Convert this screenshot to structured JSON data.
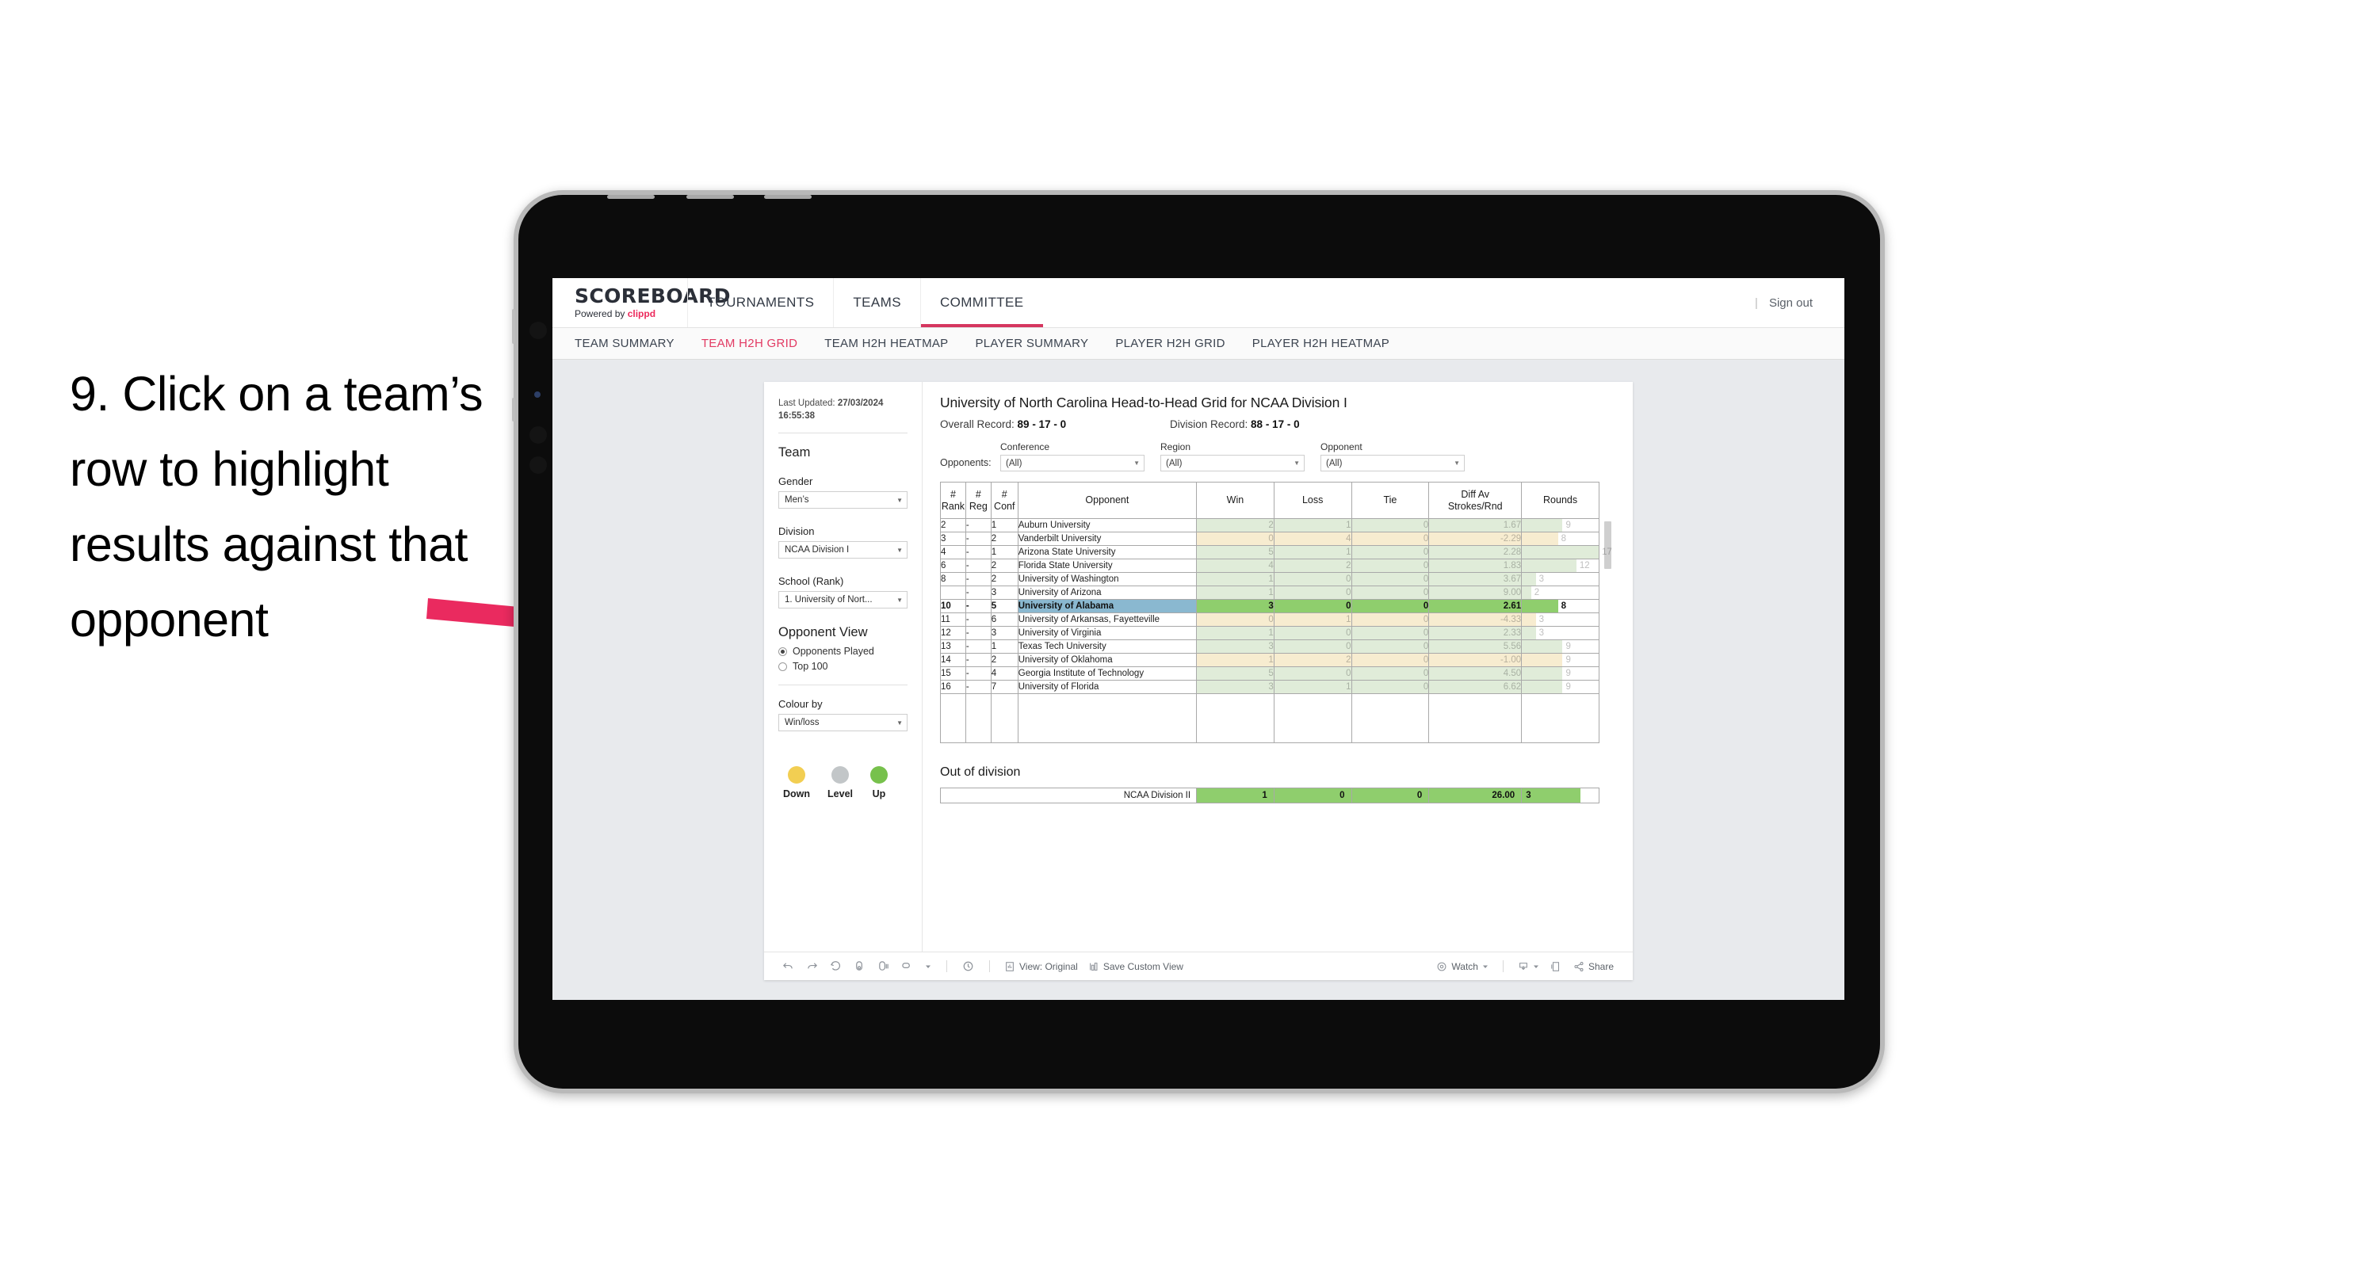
{
  "annotation": {
    "text": "9. Click on a team’s row to highlight results against that opponent",
    "arrow_color": "#ea2a5f"
  },
  "topnav": {
    "logo": "SCOREBOARD",
    "powered_prefix": "Powered by ",
    "powered_brand": "clippd",
    "items": [
      {
        "label": "TOURNAMENTS",
        "active": false
      },
      {
        "label": "TEAMS",
        "active": false
      },
      {
        "label": "COMMITTEE",
        "active": true
      }
    ],
    "separator": "|",
    "sign_out": "Sign out",
    "accent": "#d5365f"
  },
  "subnav": {
    "items": [
      {
        "label": "TEAM SUMMARY",
        "active": false
      },
      {
        "label": "TEAM H2H GRID",
        "active": true
      },
      {
        "label": "TEAM H2H HEATMAP",
        "active": false
      },
      {
        "label": "PLAYER SUMMARY",
        "active": false
      },
      {
        "label": "PLAYER H2H GRID",
        "active": false
      },
      {
        "label": "PLAYER H2H HEATMAP",
        "active": false
      }
    ]
  },
  "sidebar": {
    "last_updated_label": "Last Updated: ",
    "last_updated_value": "27/03/2024 16:55:38",
    "team_heading": "Team",
    "gender_label": "Gender",
    "gender_value": "Men’s",
    "division_label": "Division",
    "division_value": "NCAA Division I",
    "school_label": "School (Rank)",
    "school_value": "1. University of Nort...",
    "opponent_view_heading": "Opponent View",
    "opponent_view_options": [
      {
        "label": "Opponents Played",
        "selected": true
      },
      {
        "label": "Top 100",
        "selected": false
      }
    ],
    "colour_by_label": "Colour by",
    "colour_by_value": "Win/loss",
    "legend": [
      {
        "label": "Down",
        "color": "#f2ce52"
      },
      {
        "label": "Level",
        "color": "#c2c6c8"
      },
      {
        "label": "Up",
        "color": "#77c14c"
      }
    ]
  },
  "viz": {
    "title": "University of North Carolina Head-to-Head Grid for NCAA Division I",
    "overall_record_label": "Overall Record: ",
    "overall_record_value": "89 - 17 - 0",
    "division_record_label": "Division Record: ",
    "division_record_value": "88 - 17 - 0",
    "opponents_label": "Opponents:",
    "filters": [
      {
        "label": "Conference",
        "value": "(All)"
      },
      {
        "label": "Region",
        "value": "(All)"
      },
      {
        "label": "Opponent",
        "value": "(All)"
      }
    ],
    "out_of_division_title": "Out of division"
  },
  "chart_data": {
    "type": "table",
    "title": "University of North Carolina Head-to-Head Grid for NCAA Division I",
    "columns": [
      "# Rank",
      "# Reg",
      "# Conf",
      "Opponent",
      "Win",
      "Loss",
      "Tie",
      "Diff Av Strokes/Rnd",
      "Rounds"
    ],
    "column_header_lines": [
      [
        "#",
        "Rank"
      ],
      [
        "#",
        "Reg"
      ],
      [
        "#",
        "Conf"
      ],
      [
        "Opponent"
      ],
      [
        "Win"
      ],
      [
        "Loss"
      ],
      [
        "Tie"
      ],
      [
        "Diff Av",
        "Strokes/Rnd"
      ],
      [
        "Rounds"
      ]
    ],
    "rounds_max": 17,
    "rows": [
      {
        "rank": "2",
        "reg": "-",
        "conf": "1",
        "opponent": "Auburn University",
        "win": "2",
        "loss": "1",
        "tie": "0",
        "diff": "1.67",
        "rounds": "9",
        "color": "#e0ecd9",
        "highlight": false
      },
      {
        "rank": "3",
        "reg": "-",
        "conf": "2",
        "opponent": "Vanderbilt University",
        "win": "0",
        "loss": "4",
        "tie": "0",
        "diff": "-2.29",
        "rounds": "8",
        "color": "#f7ecd0",
        "highlight": false
      },
      {
        "rank": "4",
        "reg": "-",
        "conf": "1",
        "opponent": "Arizona State University",
        "win": "5",
        "loss": "1",
        "tie": "0",
        "diff": "2.28",
        "rounds": "17",
        "color": "#e0ecd9",
        "highlight": false
      },
      {
        "rank": "6",
        "reg": "-",
        "conf": "2",
        "opponent": "Florida State University",
        "win": "4",
        "loss": "2",
        "tie": "0",
        "diff": "1.83",
        "rounds": "12",
        "color": "#e0ecd9",
        "highlight": false
      },
      {
        "rank": "8",
        "reg": "-",
        "conf": "2",
        "opponent": "University of Washington",
        "win": "1",
        "loss": "0",
        "tie": "0",
        "diff": "3.67",
        "rounds": "3",
        "color": "#e0ecd9",
        "highlight": false
      },
      {
        "rank": "",
        "reg": "-",
        "conf": "3",
        "opponent": "University of Arizona",
        "win": "1",
        "loss": "0",
        "tie": "0",
        "diff": "9.00",
        "rounds": "2",
        "color": "#e0ecd9",
        "highlight": false
      },
      {
        "rank": "10",
        "reg": "-",
        "conf": "5",
        "opponent": "University of Alabama",
        "win": "3",
        "loss": "0",
        "tie": "0",
        "diff": "2.61",
        "rounds": "8",
        "color": "#8fce6d",
        "highlight": true
      },
      {
        "rank": "11",
        "reg": "-",
        "conf": "6",
        "opponent": "University of Arkansas, Fayetteville",
        "win": "0",
        "loss": "1",
        "tie": "0",
        "diff": "-4.33",
        "rounds": "3",
        "color": "#f7ecd0",
        "highlight": false
      },
      {
        "rank": "12",
        "reg": "-",
        "conf": "3",
        "opponent": "University of Virginia",
        "win": "1",
        "loss": "0",
        "tie": "0",
        "diff": "2.33",
        "rounds": "3",
        "color": "#e0ecd9",
        "highlight": false
      },
      {
        "rank": "13",
        "reg": "-",
        "conf": "1",
        "opponent": "Texas Tech University",
        "win": "3",
        "loss": "0",
        "tie": "0",
        "diff": "5.56",
        "rounds": "9",
        "color": "#e0ecd9",
        "highlight": false
      },
      {
        "rank": "14",
        "reg": "-",
        "conf": "2",
        "opponent": "University of Oklahoma",
        "win": "1",
        "loss": "2",
        "tie": "0",
        "diff": "-1.00",
        "rounds": "9",
        "color": "#f7ecd0",
        "highlight": false
      },
      {
        "rank": "15",
        "reg": "-",
        "conf": "4",
        "opponent": "Georgia Institute of Technology",
        "win": "5",
        "loss": "0",
        "tie": "0",
        "diff": "4.50",
        "rounds": "9",
        "color": "#e0ecd9",
        "highlight": false
      },
      {
        "rank": "16",
        "reg": "-",
        "conf": "7",
        "opponent": "University of Florida",
        "win": "3",
        "loss": "1",
        "tie": "0",
        "diff": "6.62",
        "rounds": "9",
        "color": "#e0ecd9",
        "highlight": false
      }
    ],
    "out_of_division": {
      "label": "NCAA Division II",
      "win": "1",
      "loss": "0",
      "tie": "0",
      "diff": "26.00",
      "rounds": "3",
      "color": "#8fce6d"
    }
  },
  "toolbar": {
    "icons": [
      "undo-icon",
      "redo-icon",
      "revert-icon",
      "refresh-icon",
      "pause-icon",
      "alerts-icon"
    ],
    "view_label": "View: Original",
    "save_custom_view_label": "Save Custom View",
    "watch_label": "Watch",
    "share_label": "Share"
  }
}
